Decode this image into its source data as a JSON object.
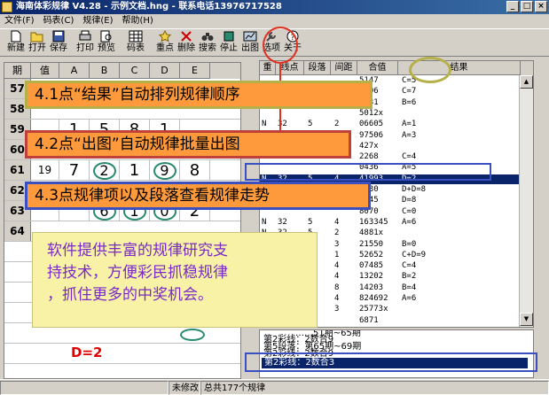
{
  "window": {
    "title": "海南体彩规律 V4.28 - 示例文档.hng - 联系电话13976717528",
    "buttons": [
      "_",
      "□",
      "×"
    ]
  },
  "menu": [
    "文件(F)",
    "码表(C)",
    "规律(E)",
    "帮助(H)"
  ],
  "toolbar": [
    {
      "name": "new",
      "label": "新建",
      "icon": "new-doc-icon"
    },
    {
      "name": "open",
      "label": "打开",
      "icon": "folder-open-icon"
    },
    {
      "name": "save",
      "label": "保存",
      "icon": "floppy-icon"
    },
    {
      "name": "print",
      "label": "打印",
      "icon": "printer-icon"
    },
    {
      "name": "preview",
      "label": "预览",
      "icon": "magnifier-icon"
    },
    {
      "name": "codetable",
      "label": "码表",
      "icon": "grid-table-icon"
    },
    {
      "name": "keypoint",
      "label": "重点",
      "icon": "star-icon"
    },
    {
      "name": "delete",
      "label": "删除",
      "icon": "x-icon"
    },
    {
      "name": "search",
      "label": "搜索",
      "icon": "binoculars-icon"
    },
    {
      "name": "stop",
      "label": "停止",
      "icon": "stop-icon"
    },
    {
      "name": "chart",
      "label": "出图",
      "icon": "chart-icon"
    },
    {
      "name": "options",
      "label": "选项",
      "icon": "wrench-icon"
    },
    {
      "name": "about",
      "label": "关于",
      "icon": "help-icon"
    }
  ],
  "left_grid": {
    "headers": [
      "期",
      "值",
      "A",
      "B",
      "C",
      "D",
      "E"
    ],
    "rows": [
      {
        "n": "57",
        "cells": [
          "",
          "",
          "",
          "",
          ""
        ]
      },
      {
        "n": "58",
        "cells": [
          "",
          "",
          "",
          "",
          ""
        ]
      },
      {
        "n": "59",
        "cells": [
          "",
          "1",
          "5",
          "8",
          "1"
        ]
      },
      {
        "n": "60",
        "cells": [
          "",
          "",
          "",
          "",
          ""
        ]
      },
      {
        "n": "61",
        "cells": [
          "19",
          "7",
          "2",
          "1",
          "9",
          "8"
        ]
      },
      {
        "n": "62",
        "cells": [
          "",
          "",
          "",
          "",
          ""
        ]
      },
      {
        "n": "63",
        "cells": [
          "",
          "",
          "6",
          "1",
          "0",
          "2"
        ]
      },
      {
        "n": "64",
        "cells": [
          "",
          "",
          "",
          "",
          ""
        ]
      }
    ],
    "d_label": "D=2"
  },
  "right_table": {
    "headers": [
      "重",
      "线点",
      "段落",
      "间距",
      "合值",
      "结果"
    ],
    "rows": [
      {
        "c": [
          "",
          "",
          "",
          "",
          "5147",
          "C=5"
        ]
      },
      {
        "c": [
          "",
          "",
          "",
          "",
          "5806",
          "C=7"
        ]
      },
      {
        "c": [
          "",
          "",
          "",
          "",
          "7931",
          "B=6"
        ]
      },
      {
        "c": [
          "",
          "",
          "",
          "",
          "5012x",
          ""
        ]
      },
      {
        "c": [
          "N",
          "32",
          "5",
          "2",
          "06605",
          "A=1"
        ]
      },
      {
        "c": [
          "",
          "",
          "",
          "",
          "97506",
          "A=3"
        ]
      },
      {
        "c": [
          "",
          "",
          "",
          "",
          "427x",
          ""
        ]
      },
      {
        "c": [
          "",
          "",
          "",
          "",
          "2268",
          "C=4"
        ]
      },
      {
        "c": [
          "",
          "",
          "",
          "",
          "0436",
          "A=5"
        ]
      },
      {
        "c": [
          "N",
          "32",
          "5",
          "4",
          "41993",
          "D=2"
        ],
        "sel": true
      },
      {
        "c": [
          "",
          "",
          "",
          "",
          "0730",
          "D+D=8"
        ]
      },
      {
        "c": [
          "",
          "",
          "",
          "",
          "0745",
          "D=8"
        ]
      },
      {
        "c": [
          "",
          "",
          "",
          "",
          "8070",
          "C=0"
        ]
      },
      {
        "c": [
          "N",
          "32",
          "5",
          "4",
          "163345",
          "A=6"
        ]
      },
      {
        "c": [
          "N",
          "32",
          "5",
          "2",
          "4881x",
          ""
        ]
      },
      {
        "c": [
          "",
          "",
          "",
          "3",
          "21550",
          "B=0"
        ]
      },
      {
        "c": [
          "",
          "",
          "",
          "1",
          "52652",
          "C+D=9"
        ]
      },
      {
        "c": [
          "",
          "",
          "",
          "4",
          "07485",
          "C=4"
        ]
      },
      {
        "c": [
          "",
          "",
          "",
          "4",
          "13202",
          "B=2"
        ]
      },
      {
        "c": [
          "",
          "",
          "",
          "8",
          "14203",
          "B=4"
        ]
      },
      {
        "c": [
          "",
          "",
          "",
          "4",
          "824692",
          "A=6"
        ]
      },
      {
        "c": [
          "",
          "",
          "",
          "3",
          "25773x",
          ""
        ]
      },
      {
        "c": [
          "",
          "",
          "",
          "",
          "6871",
          ""
        ]
      }
    ]
  },
  "bottom_panel": {
    "lines": [
      "……51期~65期",
      "第2彩线：2数合9",
      "第5段落：第65期~69期",
      "第2彩线：2数合9"
    ],
    "selected": "第2彩线：2数合3"
  },
  "status": {
    "panel1": "",
    "panel2": "未修改",
    "panel3": "总共177个规律"
  },
  "callouts": {
    "c1": "4.1点“结果”自动排列规律顺序",
    "c2": "4.2点“出图”自动规律批量出图",
    "c3": "4.3点规律项以及段落查看规律走势"
  },
  "info": {
    "line1": "软件提供丰富的规律研究支",
    "line2": "持技术，方便彩民抓稳规律",
    "line3": "，抓住更多的中奖机会。"
  },
  "colors": {
    "callout_bg": "#ff9a3c",
    "info_bg": "#f7f2a6",
    "info_text": "#7a2ac8",
    "selection": "#0a246a",
    "circle": "#2a8a70",
    "d_label": "#e00000"
  }
}
